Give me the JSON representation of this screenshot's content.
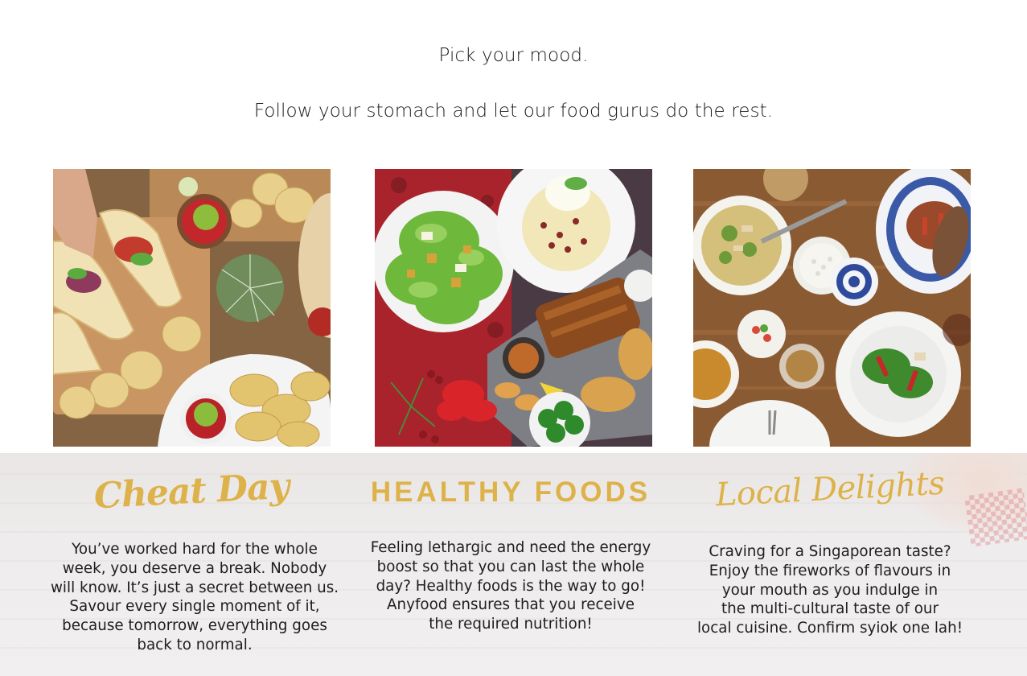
{
  "heading": {
    "line1": "Pick your mood.",
    "line2": "Follow your stomach and let our food gurus do the rest."
  },
  "cards": [
    {
      "title": "Cheat Day",
      "image": "tacos-nachos-guacamole-photo",
      "description_lines": [
        "You’ve worked hard for the whole",
        "week, you deserve a break. Nobody",
        "will know. It’s just a secret between us.",
        "Savour every single moment of it,",
        "because tomorrow, everything goes",
        "back to normal."
      ]
    },
    {
      "title": "HEALTHY FOODS",
      "image": "salad-ribs-platter-photo",
      "description_lines": [
        "Feeling lethargic and need the energy",
        "boost so that you can last the whole",
        "day? Healthy foods is the way to go!",
        "Anyfood ensures that you receive",
        "the required nutrition!"
      ]
    },
    {
      "title": "Local Delights",
      "image": "singaporean-dishes-table-photo",
      "description_lines": [
        "Craving for a Singaporean taste?",
        "Enjoy the fireworks of flavours in",
        "your mouth as you indulge in",
        "the multi-cultural taste of our",
        "local cuisine. Confirm syiok one lah!"
      ]
    }
  ],
  "colors": {
    "title_gold": "#deb24a",
    "band_background": "#eeecec",
    "text": "#1e1e1e"
  }
}
